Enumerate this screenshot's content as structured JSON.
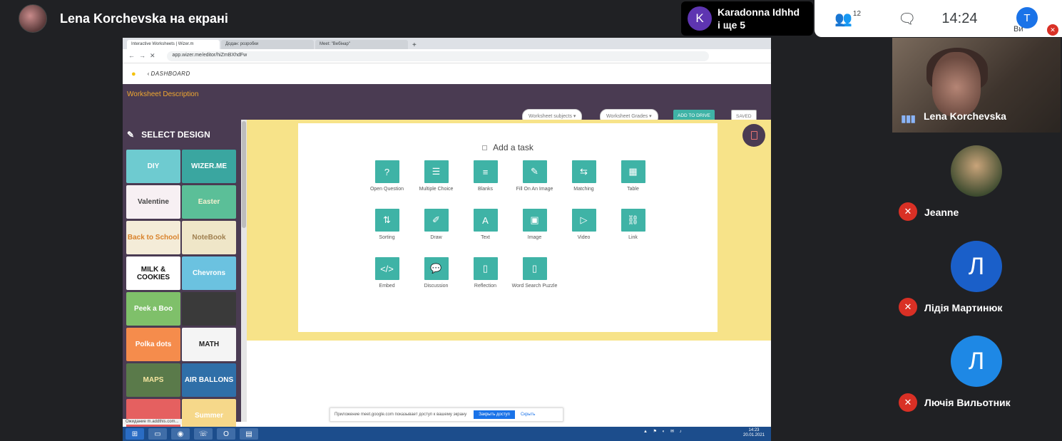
{
  "presenter": {
    "title": "Lena Korchevska на екрані"
  },
  "others": {
    "initial": "K",
    "line1": "Karadonna Idhhd",
    "line2": "і ще 5"
  },
  "controls": {
    "participants_count": "12",
    "time": "14:24",
    "self_initial": "T",
    "self_label": "Ви"
  },
  "browser": {
    "tabs": [
      "Interactive Worksheets | Wizer.m",
      "Додан: розробки",
      "Meet: \"Вебінар\""
    ],
    "url": "app.wizer.me/editor/hiZmBXhdFw"
  },
  "wizer": {
    "dashboard": "DASHBOARD",
    "worksheet_description": "Worksheet Description",
    "subjects": "Worksheet subjects ▾",
    "grades": "Worksheet Grades ▾",
    "add_to_drive": "ADD TO DRIVE",
    "saved": "SAVED",
    "select_design": "SELECT DESIGN",
    "designs": [
      {
        "label": "DIY",
        "bg": "#6ecbd0",
        "fg": "#ffffff"
      },
      {
        "label": "WIZER.ME",
        "bg": "#3aa6a0",
        "fg": "#ffffff"
      },
      {
        "label": "Valentine",
        "bg": "#f7f0f3",
        "fg": "#444444"
      },
      {
        "label": "Easter",
        "bg": "#5bbf98",
        "fg": "#f4f0d0"
      },
      {
        "label": "Back to School",
        "bg": "#f4ecd8",
        "fg": "#d9822b"
      },
      {
        "label": "NoteBook",
        "bg": "#efe6c8",
        "fg": "#a08050"
      },
      {
        "label": "MILK & COOKIES",
        "bg": "#ffffff",
        "fg": "#111111"
      },
      {
        "label": "Chevrons",
        "bg": "#6bc2e0",
        "fg": "#ffffff"
      },
      {
        "label": "Peek a Boo",
        "bg": "#7fc06a",
        "fg": "#ffffff"
      },
      {
        "label": "",
        "bg": "#3a3a3a",
        "fg": "#ffffff"
      },
      {
        "label": "Polka dots",
        "bg": "#f58c4c",
        "fg": "#ffffff"
      },
      {
        "label": "MATH",
        "bg": "#f4f4f4",
        "fg": "#222222"
      },
      {
        "label": "MAPS",
        "bg": "#5a7a4a",
        "fg": "#f6e6a0"
      },
      {
        "label": "AIR BALLONS",
        "bg": "#2f6fa8",
        "fg": "#ffffff"
      },
      {
        "label": "",
        "bg": "#e56060",
        "fg": "#ffffff"
      },
      {
        "label": "Summer",
        "bg": "#f6d88a",
        "fg": "#ffffff"
      }
    ],
    "add_task": "Add a task",
    "tasks": [
      {
        "label": "Open Question",
        "glyph": "?"
      },
      {
        "label": "Multiple Choice",
        "glyph": "☰"
      },
      {
        "label": "Blanks",
        "glyph": "≡"
      },
      {
        "label": "Fill On An Image",
        "glyph": "✎"
      },
      {
        "label": "Matching",
        "glyph": "⇆"
      },
      {
        "label": "Table",
        "glyph": "▦"
      },
      {
        "label": "Sorting",
        "glyph": "⇅"
      },
      {
        "label": "Draw",
        "glyph": "✐"
      },
      {
        "label": "Text",
        "glyph": "A"
      },
      {
        "label": "Image",
        "glyph": "▣"
      },
      {
        "label": "Video",
        "glyph": "▷"
      },
      {
        "label": "Link",
        "glyph": "⛓"
      },
      {
        "label": "Embed",
        "glyph": "</>"
      },
      {
        "label": "Discussion",
        "glyph": "💬"
      },
      {
        "label": "Reflection",
        "glyph": "▯"
      },
      {
        "label": "Word Search Puzzle",
        "glyph": "▯"
      }
    ],
    "notice": "Приложение meet.google.com показывает доступ к вашему экрану",
    "notice_stop": "Закрыть доступ",
    "notice_hide": "Скрыть",
    "status": "Ожидание m.addthis.com...",
    "taskbar_time": "14:23",
    "taskbar_date": "20.01.2021"
  },
  "participants": [
    {
      "name": "Lena Korchevska"
    },
    {
      "name": "Jeanne"
    },
    {
      "name": "Лідія Мартинюк",
      "initial": "Л"
    },
    {
      "name": "Лючія Вильотник",
      "initial": "Л"
    }
  ]
}
